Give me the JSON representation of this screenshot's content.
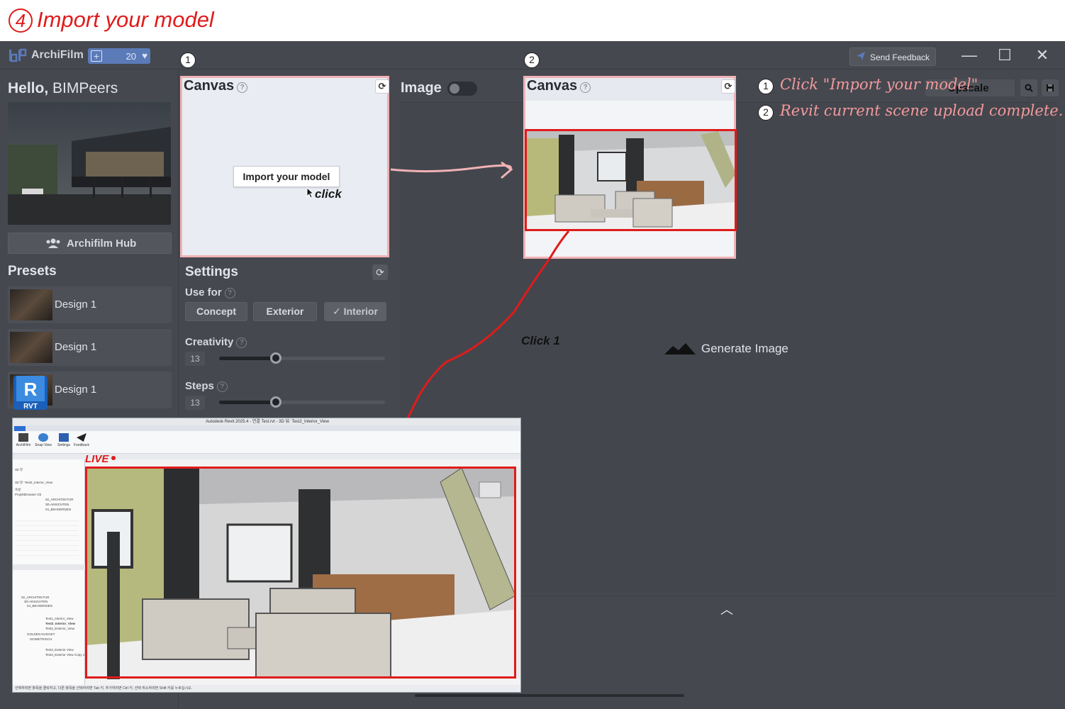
{
  "banner": {
    "step": "4",
    "title": "Import your model"
  },
  "titlebar": {
    "app_name": "ArchiFilm",
    "credits_plus": "+",
    "credits": "20",
    "credits_icon": "heart-icon",
    "feedback_label": "Send Feedback",
    "minimize": "—",
    "maximize": "☐",
    "close": "✕"
  },
  "sidebar": {
    "hello_prefix": "Hello,",
    "hello_name": "BIMPeers",
    "hub_label": "Archifilm Hub",
    "presets_title": "Presets",
    "presets": [
      {
        "label": "Design 1"
      },
      {
        "label": "Design 1"
      },
      {
        "label": "Design 1"
      }
    ],
    "rvt_letter": "R",
    "rvt_label": "RVT"
  },
  "canvas1": {
    "badge": "1",
    "title": "Canvas",
    "help": "?",
    "refresh": "⟳",
    "import_label": "Import your model",
    "click_text": "click"
  },
  "canvas2": {
    "badge": "2",
    "title": "Canvas",
    "help": "?",
    "refresh": "⟳"
  },
  "settings": {
    "title": "Settings",
    "reset": "⟳",
    "use_for_label": "Use for",
    "help": "?",
    "use_for_options": [
      {
        "label": "Concept",
        "selected": false
      },
      {
        "label": "Exterior",
        "selected": false
      },
      {
        "label": "✓ Interior",
        "selected": true
      }
    ],
    "creativity_label": "Creativity",
    "creativity_value": "13",
    "creativity_fraction": 0.34,
    "steps_label": "Steps",
    "steps_value": "13",
    "steps_fraction": 0.34
  },
  "main": {
    "image_label": "Image",
    "image_toggle_on": false,
    "upscale_label": "Upscale",
    "search_icon": "search-icon",
    "save_icon": "save-icon",
    "generate_label": "Generate Image",
    "click1_label": "Click 1",
    "expand_icon": "chevron-up-icon"
  },
  "notes": [
    {
      "num": "1",
      "text": "Click \"Import your model\""
    },
    {
      "num": "2",
      "text": "Revit current scene upload complete."
    }
  ],
  "revit": {
    "live_label": "LIVE",
    "title": "Autodesk Revit 2025.4 - 연결 Test.rvt - 3D 뷰: Test2_Interior_View",
    "tools": [
      {
        "label": "ArchiFilm"
      },
      {
        "label": "Snap View"
      },
      {
        "label": "Settings"
      },
      {
        "label": "Feedback"
      }
    ],
    "browser_items": [
      "3D 뷰",
      "3D 뷰: Test2_Interior_View",
      "속성",
      "Projektbrowser Gb",
      "02_ARCHITEKTUR",
      "3D-ANSICHTEN",
      "04_BEHOERDEN",
      "Test1_Interior_View",
      "Test2_Interior_View",
      "Test3_Exterior_View",
      "GOLDEN NUGGET",
      "ISOMETRISCH",
      "Test3_Exterior View",
      "Test3_Exterior View Copy 1"
    ],
    "status": "선택하려면 항목을 클릭하고, 다른 항목을 선택하려면 Tab 키, 추가하려면 Ctrl 키, 선택 취소하려면 Shift 키를 누르십시오."
  },
  "colors": {
    "accent_red": "#e01b1b",
    "note_pink": "#f49a9d",
    "frame_pink": "#f0b2b5",
    "app_bg": "#45484f",
    "credits_blue": "#5b7ab8"
  }
}
